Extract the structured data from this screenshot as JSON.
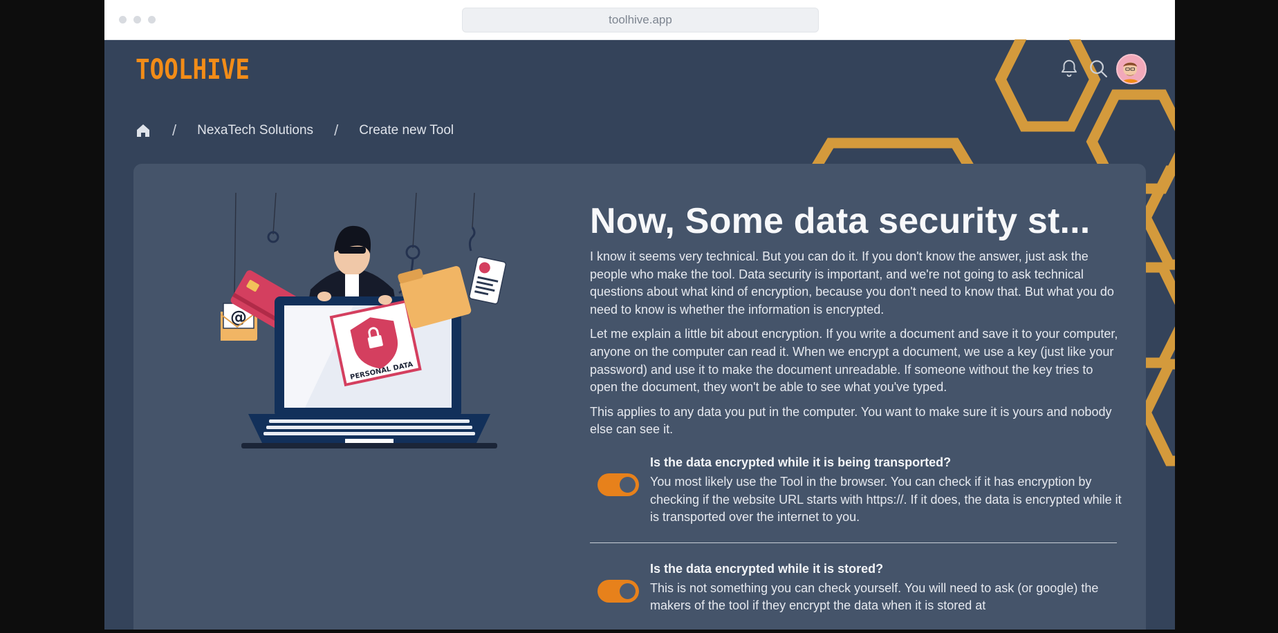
{
  "browser": {
    "url": "toolhive.app"
  },
  "header": {
    "logo_text": "TOOLHIVE",
    "icons": [
      "bell-icon",
      "search-icon",
      "avatar"
    ]
  },
  "breadcrumb": {
    "items": [
      "NexaTech Solutions",
      "Create new Tool"
    ],
    "separator": "/"
  },
  "illustration": {
    "envelope_symbol": "@",
    "laptop_label": "PERSONAL DATA"
  },
  "main": {
    "title": "Now, Some data security st...",
    "paragraphs": [
      "I know it seems very technical. But you can do it. If you don't know the answer, just ask the people who make the tool. Data security is important, and we're not going to ask technical questions about what kind of encryption, because you don't need to know that. But what you do need to know is whether the information is encrypted.",
      "Let me explain a little bit about encryption. If you write a document and save it to your computer, anyone on the computer can read it. When we encrypt a document, we use a key (just like your password) and use it to make the document unreadable. If someone without the key tries to open the document, they won't be able to see what you've typed.",
      "This applies to any data you put in the computer. You want to make sure it is yours and nobody else can see it."
    ],
    "questions": [
      {
        "title": "Is the data encrypted while it is being transported?",
        "body": "You most likely use the Tool in the browser. You can check if it has encryption by checking if the website URL starts with https://. If it does, the data is encrypted while it is transported over the internet to you.",
        "toggle_on": true
      },
      {
        "title": "Is the data encrypted while it is stored?",
        "body": "This is not something you can check yourself. You will need to ask (or google) the makers of the tool if they encrypt the data when it is stored at",
        "toggle_on": true
      }
    ]
  },
  "colors": {
    "accent": "#e7811b",
    "hexagon": "#d49a3c",
    "background": "#34435a",
    "card": "#45546a"
  }
}
